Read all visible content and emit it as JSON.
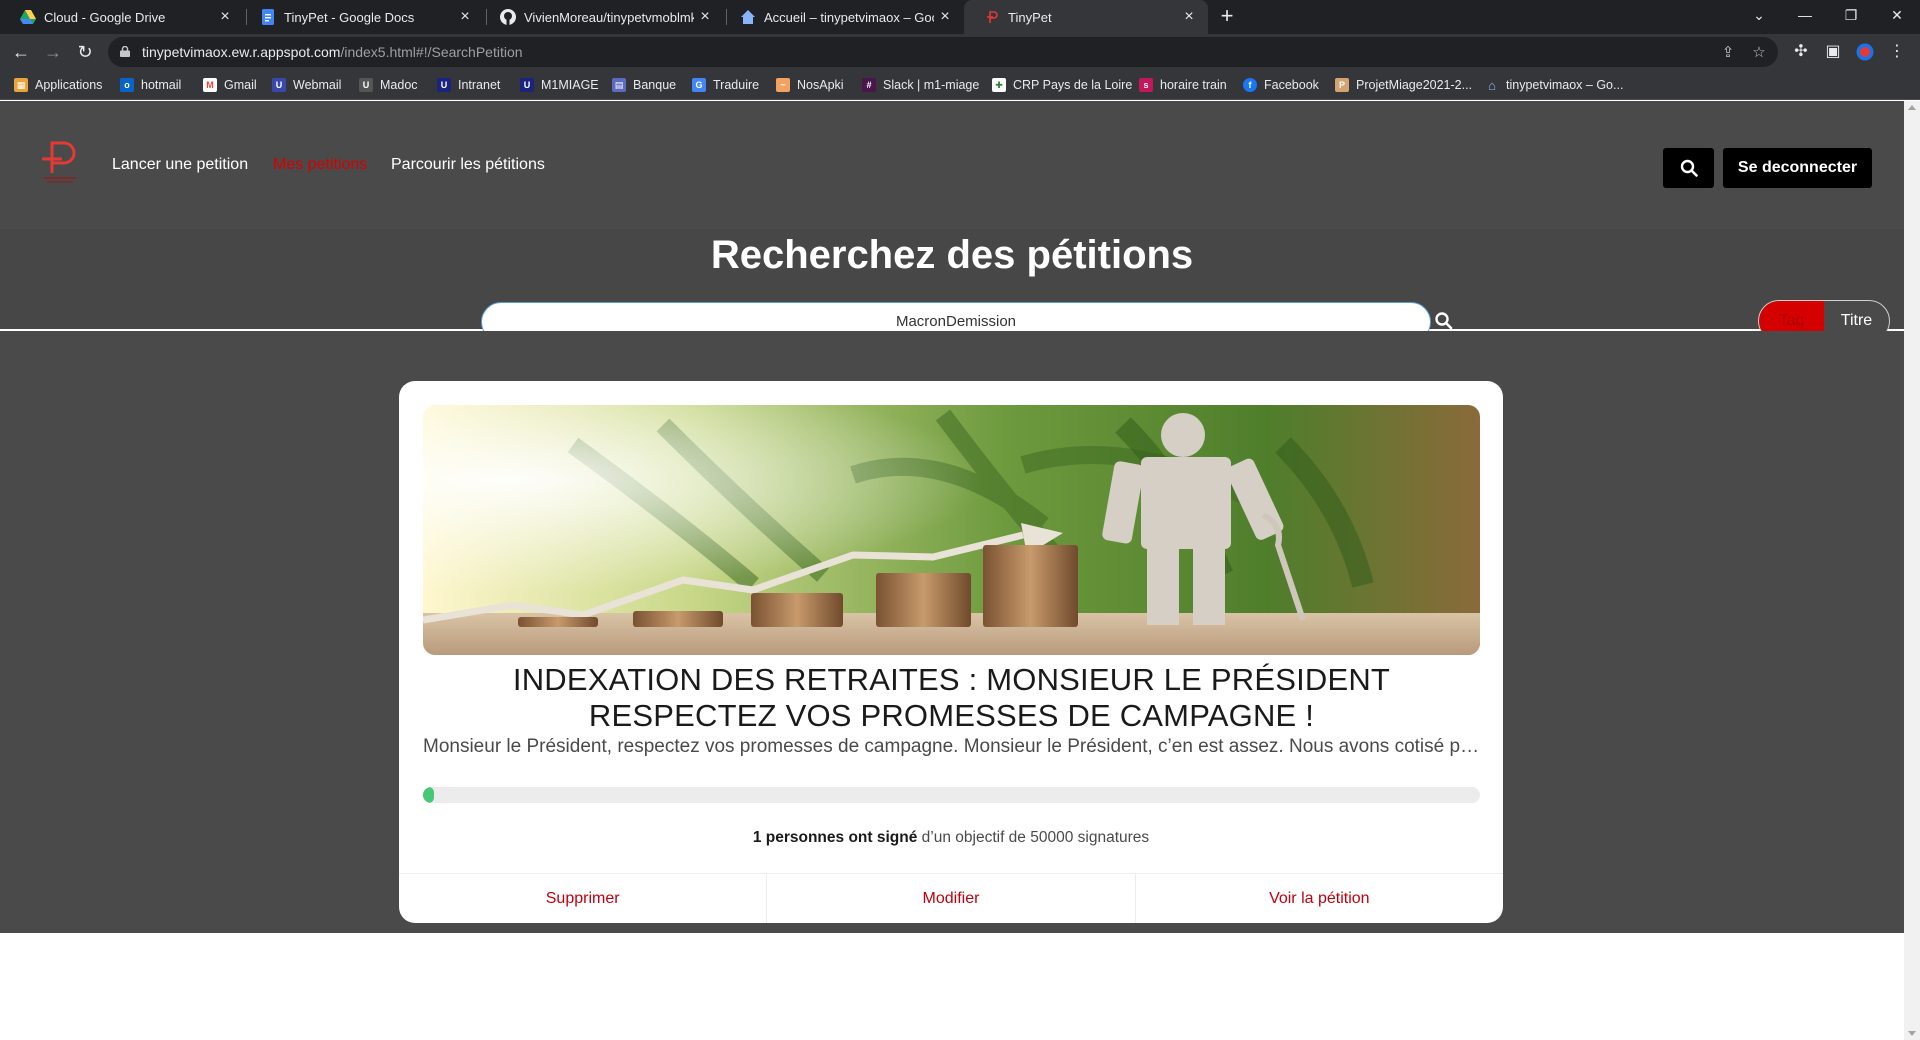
{
  "browser": {
    "tabs": [
      {
        "title": "Cloud - Google Drive",
        "icon": "google-drive-icon"
      },
      {
        "title": "TinyPet - Google Docs",
        "icon": "google-docs-icon"
      },
      {
        "title": "VivienMoreau/tinypetvmoblmk",
        "icon": "github-icon"
      },
      {
        "title": "Accueil – tinypetvimaox – Google",
        "icon": "app-engine-icon"
      },
      {
        "title": "TinyPet",
        "icon": "tinypet-icon",
        "active": true
      }
    ],
    "url_host": "tinypetvimaox.ew.r.appspot.com",
    "url_path": "/index5.html#!/SearchPetition",
    "bookmarks": [
      {
        "label": "Applications",
        "icon": "apps-grid-icon",
        "color": "#e8a33d"
      },
      {
        "label": "hotmail",
        "icon": "outlook-icon",
        "color": "#0a64c8"
      },
      {
        "label": "Gmail",
        "icon": "gmail-icon",
        "color": "#ea4335"
      },
      {
        "label": "Webmail",
        "icon": "webmail-icon",
        "color": "#3949ab"
      },
      {
        "label": "Madoc",
        "icon": "madoc-icon",
        "color": "#555555"
      },
      {
        "label": "Intranet",
        "icon": "intranet-icon",
        "color": "#1a237e"
      },
      {
        "label": "M1MIAGE",
        "icon": "m1miage-icon",
        "color": "#1a237e"
      },
      {
        "label": "Banque",
        "icon": "bank-icon",
        "color": "#5c6bc0"
      },
      {
        "label": "Traduire",
        "icon": "translate-icon",
        "color": "#4285f4"
      },
      {
        "label": "NosApki",
        "icon": "nosapki-icon",
        "color": "#f4a261"
      },
      {
        "label": "Slack | m1-miage",
        "icon": "slack-icon",
        "color": "#4a154b"
      },
      {
        "label": "CRP Pays de la Loire",
        "icon": "crp-icon",
        "color": "#ffffff"
      },
      {
        "label": "horaire train",
        "icon": "sncf-icon",
        "color": "#c2185b"
      },
      {
        "label": "Facebook",
        "icon": "facebook-icon",
        "color": "#1877f2"
      },
      {
        "label": "ProjetMiage2021-2...",
        "icon": "project-icon",
        "color": "#d4a373"
      },
      {
        "label": "tinypetvimaox – Go...",
        "icon": "app-engine-icon",
        "color": "#4285f4"
      }
    ]
  },
  "site": {
    "nav": {
      "launch": "Lancer une petition",
      "mine": "Mes petitions",
      "browse": "Parcourir les pétitions",
      "logout": "Se deconnecter"
    },
    "search": {
      "heading": "Recherchez des pétitions",
      "query": "MacronDemission",
      "toggle_tag": "Tag",
      "toggle_title": "Titre"
    },
    "petition": {
      "title": "INDEXATION DES RETRAITES : MONSIEUR LE PRÉSIDENT RESPECTEZ VOS PROMESSES DE CAMPAGNE !",
      "description": "Monsieur le Président, respectez vos promesses de campagne. Monsieur le Président, c’en est assez. Nous avons cotisé pendant des années",
      "signed_count_text": "1 personnes ont signé",
      "goal_text": "d’un objectif de 50000 signatures",
      "progress_fraction": 0.01,
      "actions": {
        "delete": "Supprimer",
        "edit": "Modifier",
        "view": "Voir la pétition"
      }
    },
    "colors": {
      "accent": "#d50000",
      "nav_bg": "#4a4a4a",
      "progress": "#48c774"
    }
  }
}
